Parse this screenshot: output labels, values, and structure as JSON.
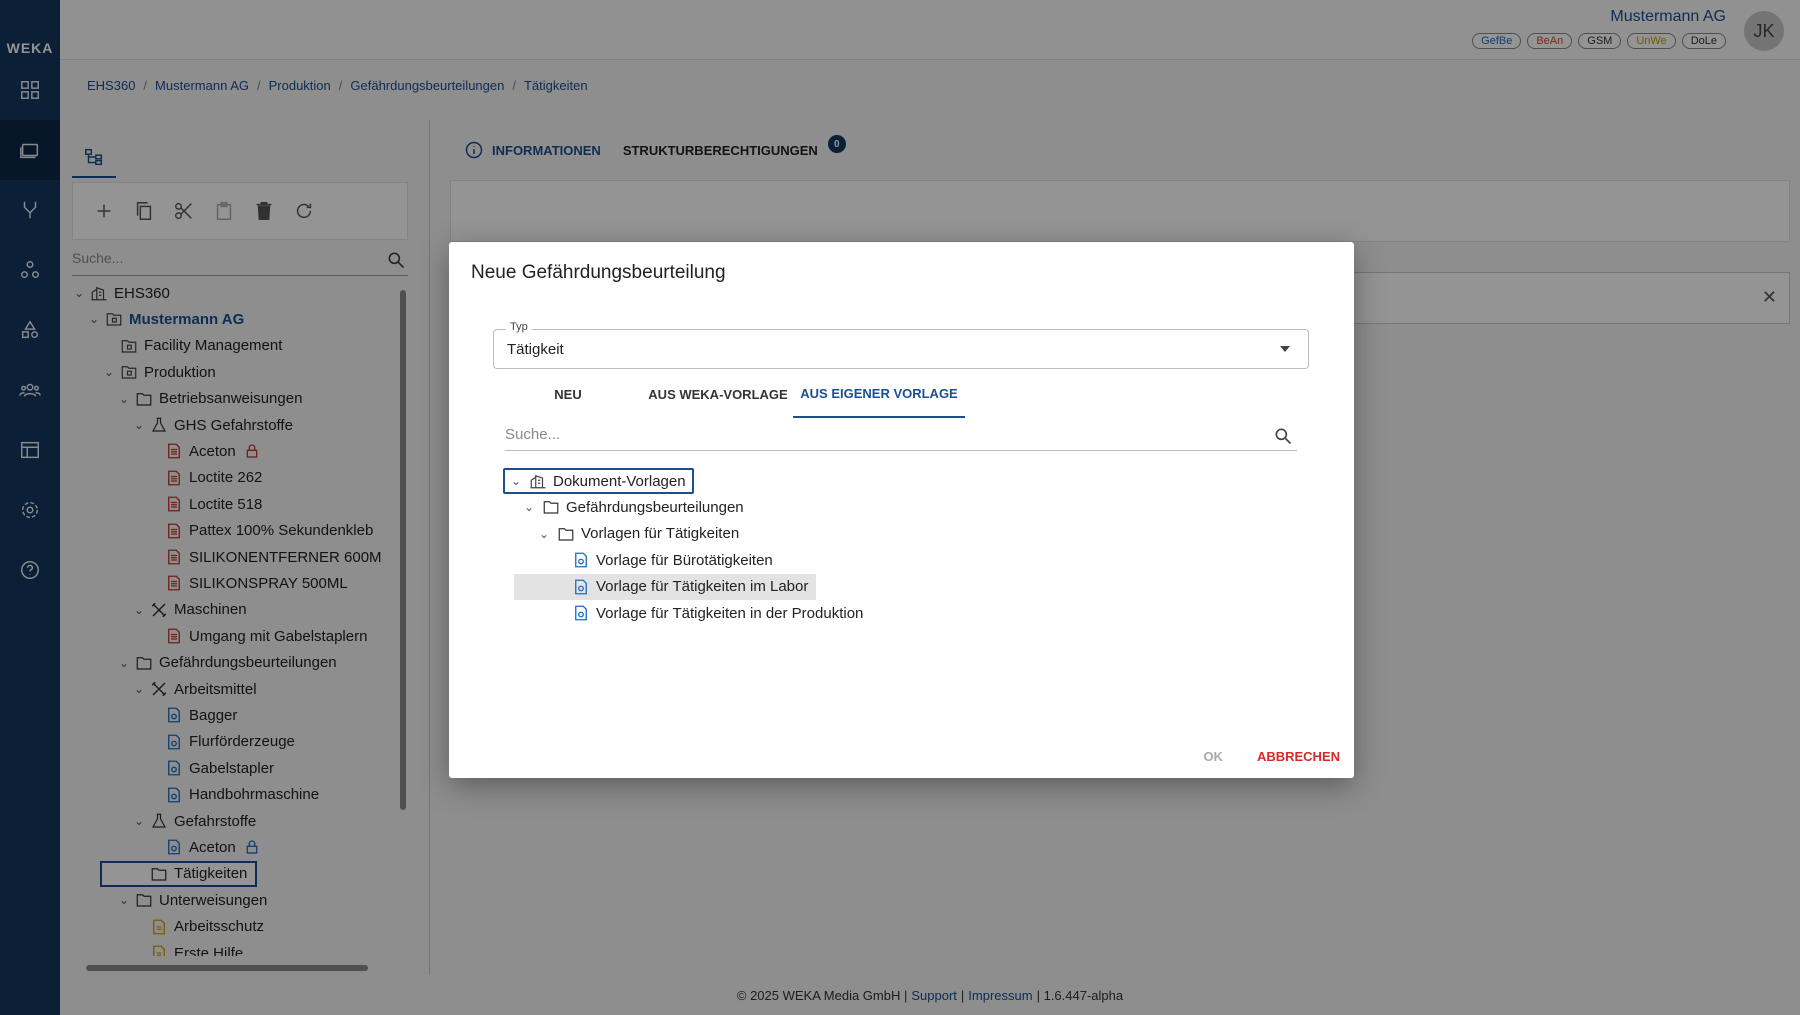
{
  "app": {
    "logo": "WEKA"
  },
  "header": {
    "company": "Mustermann AG",
    "badges": [
      {
        "label": "GefBe",
        "color": "#1b6fc2"
      },
      {
        "label": "BeAn",
        "color": "#d24b2b"
      },
      {
        "label": "GSM",
        "color": "#333333"
      },
      {
        "label": "UnWe",
        "color": "#c8a000"
      },
      {
        "label": "DoLe",
        "color": "#333333"
      }
    ],
    "avatar": "JK"
  },
  "breadcrumb": [
    "EHS360",
    "Mustermann AG",
    "Produktion",
    "Gefährdungsbeurteilungen",
    "Tätigkeiten"
  ],
  "left_panel": {
    "search_placeholder": "Suche...",
    "tree": [
      {
        "label": "EHS360",
        "icon": "building-icon",
        "chev": "v"
      },
      {
        "label": "Mustermann AG",
        "icon": "company-folder-icon",
        "chev": "v",
        "bold": true
      },
      {
        "label": "Facility Management",
        "icon": "company-folder-icon",
        "chev": ""
      },
      {
        "label": "Produktion",
        "icon": "company-folder-icon",
        "chev": "v"
      },
      {
        "label": "Betriebsanweisungen",
        "icon": "folder-icon",
        "chev": "v"
      },
      {
        "label": "GHS Gefahrstoffe",
        "icon": "flask-icon",
        "chev": "v"
      },
      {
        "label": "Aceton",
        "icon": "red-doc-icon",
        "chev": "",
        "lock": "red"
      },
      {
        "label": "Loctite 262",
        "icon": "red-doc-icon",
        "chev": ""
      },
      {
        "label": "Loctite 518",
        "icon": "red-doc-icon",
        "chev": ""
      },
      {
        "label": "Pattex 100% Sekundenkleb",
        "icon": "red-doc-icon",
        "chev": ""
      },
      {
        "label": "SILIKONENTFERNER 600M",
        "icon": "red-doc-icon",
        "chev": ""
      },
      {
        "label": "SILIKONSPRAY 500ML",
        "icon": "red-doc-icon",
        "chev": ""
      },
      {
        "label": "Maschinen",
        "icon": "tools-icon",
        "chev": "v"
      },
      {
        "label": "Umgang mit Gabelstaplern",
        "icon": "red-doc-icon",
        "chev": ""
      },
      {
        "label": "Gefährdungsbeurteilungen",
        "icon": "folder-icon",
        "chev": "v"
      },
      {
        "label": "Arbeitsmittel",
        "icon": "tools-icon",
        "chev": "v"
      },
      {
        "label": "Bagger",
        "icon": "blue-doc-icon",
        "chev": ""
      },
      {
        "label": "Flurförderzeuge",
        "icon": "blue-doc-icon",
        "chev": ""
      },
      {
        "label": "Gabelstapler",
        "icon": "blue-doc-icon",
        "chev": ""
      },
      {
        "label": "Handbohrmaschine",
        "icon": "blue-doc-icon",
        "chev": ""
      },
      {
        "label": "Gefahrstoffe",
        "icon": "flask-icon",
        "chev": "v"
      },
      {
        "label": "Aceton",
        "icon": "blue-doc-icon",
        "chev": "",
        "lock": "blue"
      },
      {
        "label": "Tätigkeiten",
        "icon": "folder-icon",
        "chev": "",
        "selected": true
      },
      {
        "label": "Unterweisungen",
        "icon": "folder-icon",
        "chev": "v"
      },
      {
        "label": "Arbeitsschutz",
        "icon": "yellow-doc-icon",
        "chev": ""
      },
      {
        "label": "Erste Hilfe",
        "icon": "yellow-doc-icon",
        "chev": ""
      }
    ],
    "levels": [
      0,
      1,
      2,
      2,
      3,
      4,
      5,
      5,
      5,
      5,
      5,
      5,
      4,
      5,
      3,
      4,
      5,
      5,
      5,
      5,
      4,
      5,
      4,
      3,
      4,
      4
    ]
  },
  "right": {
    "tabs": [
      {
        "label": "INFORMATIONEN",
        "active": true
      },
      {
        "label": "STRUKTURBERECHTIGUNGEN",
        "count": "0"
      }
    ]
  },
  "footer": {
    "copyright": "© 2025 WEKA Media GmbH |",
    "support": "Support",
    "sep": "|",
    "impressum": "Impressum",
    "version": "| 1.6.447-alpha"
  },
  "dialog": {
    "title": "Neue Gefährdungsbeurteilung",
    "typ_label": "Typ",
    "typ_value": "Tätigkeit",
    "tabs": [
      "NEU",
      "AUS WEKA-VORLAGE",
      "AUS EIGENER VORLAGE"
    ],
    "active_tab": 2,
    "search_placeholder": "Suche...",
    "tree": [
      {
        "label": "Dokument-Vorlagen",
        "icon": "building-icon",
        "chev": "v",
        "level": 0,
        "focused": true
      },
      {
        "label": "Gefährdungsbeurteilungen",
        "icon": "folder-icon",
        "chev": "v",
        "level": 1
      },
      {
        "label": "Vorlagen für Tätigkeiten",
        "icon": "folder-icon",
        "chev": "v",
        "level": 2
      },
      {
        "label": "Vorlage für Bürotätigkeiten",
        "icon": "blue-doc-icon",
        "chev": "",
        "level": 3
      },
      {
        "label": "Vorlage für Tätigkeiten im Labor",
        "icon": "blue-doc-icon",
        "chev": "",
        "level": 3,
        "highlighted": true
      },
      {
        "label": "Vorlage für Tätigkeiten in der Produktion",
        "icon": "blue-doc-icon",
        "chev": "",
        "level": 3
      }
    ],
    "ok": "OK",
    "cancel": "ABBRECHEN"
  },
  "colors": {
    "brand": "#14365f",
    "link": "#1b4f91",
    "danger": "#d52b2b"
  }
}
